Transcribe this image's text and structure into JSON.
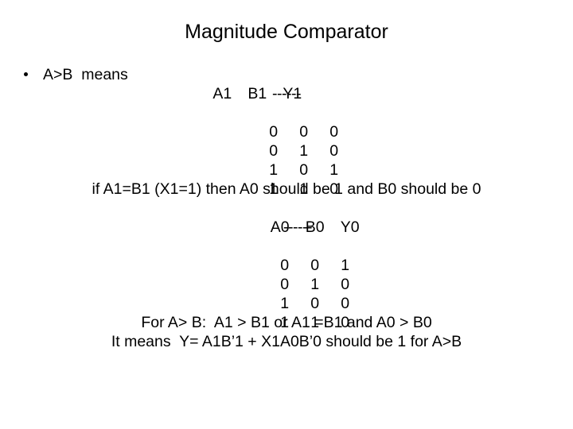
{
  "title": "Magnitude Comparator",
  "bullet": {
    "marker": "•",
    "text": "A>B  means"
  },
  "table1": {
    "headers": [
      "A1",
      "B1",
      "Y1"
    ],
    "separator": "------",
    "rows": [
      [
        "0",
        "0",
        "0"
      ],
      [
        "0",
        "1",
        "0"
      ],
      [
        "1",
        "0",
        "1"
      ],
      [
        "1",
        "1",
        "0"
      ]
    ]
  },
  "note": "if A1=B1 (X1=1) then A0 should be 1 and B0 should be 0",
  "table2": {
    "headers": [
      "A0",
      "B0",
      "Y0"
    ],
    "separator": "------",
    "rows": [
      [
        "0",
        "0",
        "1"
      ],
      [
        "0",
        "1",
        "0"
      ],
      [
        "1",
        "0",
        "0"
      ],
      [
        "1",
        "1",
        "0"
      ]
    ]
  },
  "conclusion": {
    "line1": "For A> B:  A1 > B1 or A1 =B1 and A0 > B0",
    "line2": "It means  Y= A1B’1 + X1A0B’0 should be 1 for A>B"
  }
}
